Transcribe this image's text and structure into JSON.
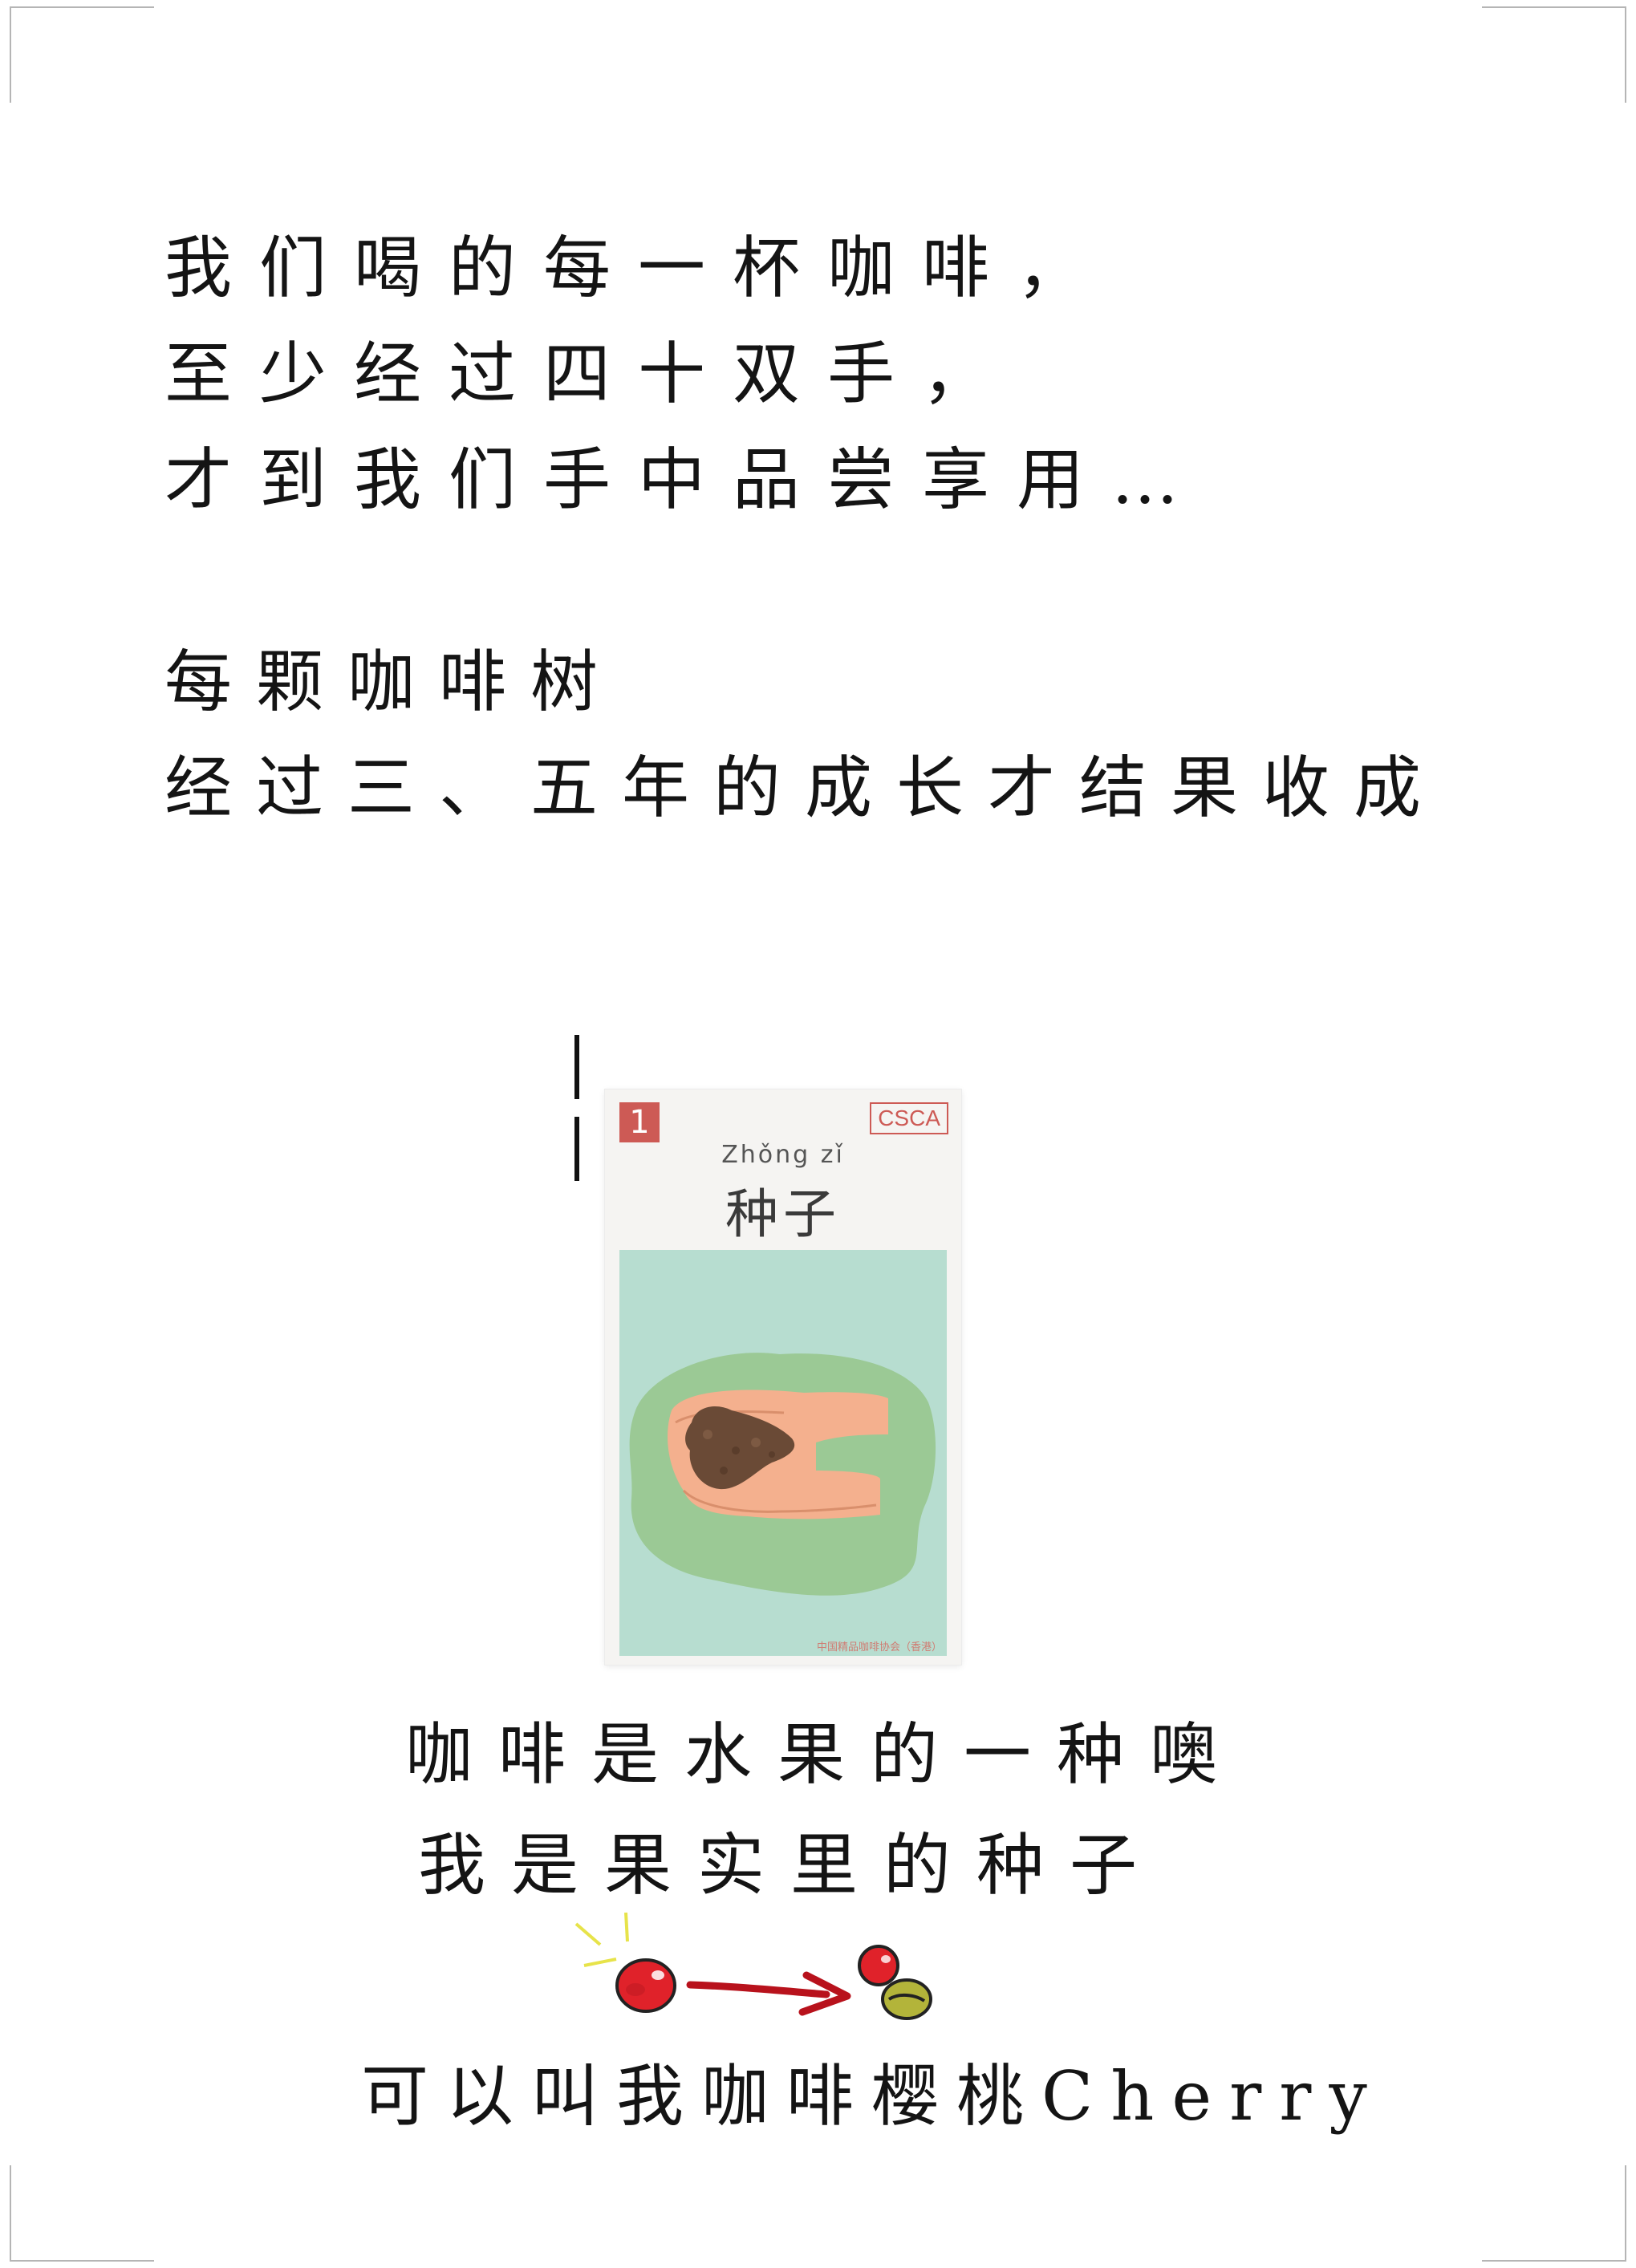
{
  "intro": {
    "lines": [
      "我们喝的每一杯咖啡，",
      "至少经过四十双手，",
      "才到我们手中品尝享用…"
    ]
  },
  "growth": {
    "lines": [
      "每颗咖啡树",
      "经过三、五年的成长才结果收成"
    ]
  },
  "card": {
    "number": "1",
    "brand": "CSCA",
    "pinyin": "Zhǒng zǐ",
    "title": "种子",
    "footer": "中国精品咖啡协会（香港）",
    "colors": {
      "accent": "#cd5a55",
      "illustration_bg": "#b7ddd0",
      "soil": "#6a4a36",
      "hands": "#f4b08e",
      "grass": "#9bc995"
    }
  },
  "fruit_note": {
    "lines": [
      "咖啡是水果的一种噢",
      "我是果实里的种子"
    ]
  },
  "cherry_caption": "可以叫我咖啡樱桃Cherry"
}
